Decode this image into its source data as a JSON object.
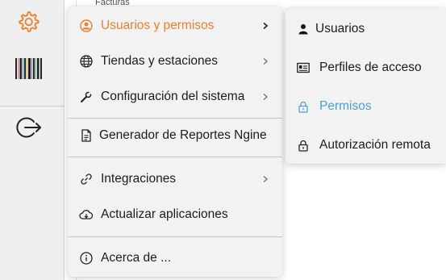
{
  "background": {
    "tab_label": "Facturas"
  },
  "colors": {
    "accent": "#f07d2b",
    "hover": "#4a9fd8",
    "menu_bg": "#f2f2f2",
    "rail_bg": "#efefef"
  },
  "rail": {
    "items": [
      {
        "icon": "gear-icon",
        "active": true
      },
      {
        "icon": "barcode-icon",
        "active": false
      },
      {
        "icon": "logout-icon",
        "active": false
      }
    ]
  },
  "menu": {
    "items": [
      {
        "label": "Usuarios y permisos",
        "icon": "user-circle-icon",
        "has_submenu": true,
        "active": true
      },
      {
        "label": "Tiendas y estaciones",
        "icon": "globe-icon",
        "has_submenu": true
      },
      {
        "label": "Configuración del sistema",
        "icon": "wrench-icon",
        "has_submenu": true
      },
      {
        "label": "Generador de Reportes Ngine",
        "icon": "document-icon",
        "has_submenu": false
      },
      {
        "label": "Integraciones",
        "icon": "link-icon",
        "has_submenu": true
      },
      {
        "label": "Actualizar aplicaciones",
        "icon": "cloud-download-icon",
        "has_submenu": false
      },
      {
        "label": "Acerca de ...",
        "icon": "info-icon",
        "has_submenu": false
      }
    ]
  },
  "submenu": {
    "items": [
      {
        "label": "Usuarios",
        "icon": "user-icon"
      },
      {
        "label": "Perfiles de acceso",
        "icon": "id-card-icon"
      },
      {
        "label": "Permisos",
        "icon": "lock-icon",
        "hover": true
      },
      {
        "label": "Autorización remota",
        "icon": "lock-icon"
      }
    ]
  }
}
